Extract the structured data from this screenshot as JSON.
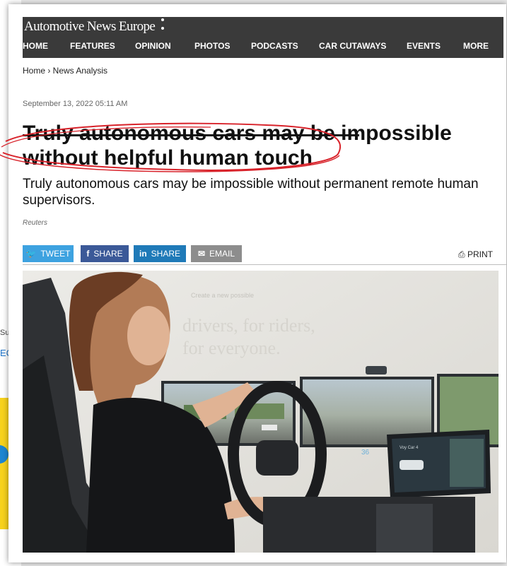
{
  "background_page": {
    "text1": "Subsc",
    "text2": "EC"
  },
  "site": {
    "brand": "Automotive News Europe",
    "nav": [
      "HOME",
      "FEATURES",
      "OPINION",
      "PHOTOS",
      "PODCASTS",
      "CAR CUTAWAYS",
      "EVENTS",
      "MORE"
    ]
  },
  "breadcrumb": "Home › News Analysis",
  "article": {
    "timestamp": "September 13, 2022 05:11 AM",
    "headline": "Truly autonomous cars may be impossible without helpful human touch",
    "deck": "Truly autonomous cars may be impossible without permanent remote human supervisors.",
    "source": "Reuters"
  },
  "share": {
    "tweet": "TWEET",
    "facebook": "SHARE",
    "linkedin": "SHARE",
    "email": "EMAIL",
    "print": "PRINT"
  },
  "hero_image": {
    "screen_line1": "Create a new possible",
    "screen_line2": "drivers, for riders,",
    "screen_line3": "for everyone.",
    "dash_label": "Voy Car 4",
    "speed": "36"
  },
  "colors": {
    "header_bg": "#3a3a3a",
    "twitter": "#3da2e0",
    "facebook": "#3b5998",
    "linkedin": "#1f7ab8",
    "email": "#8d8d8d",
    "annotation_red": "#d8222a"
  }
}
